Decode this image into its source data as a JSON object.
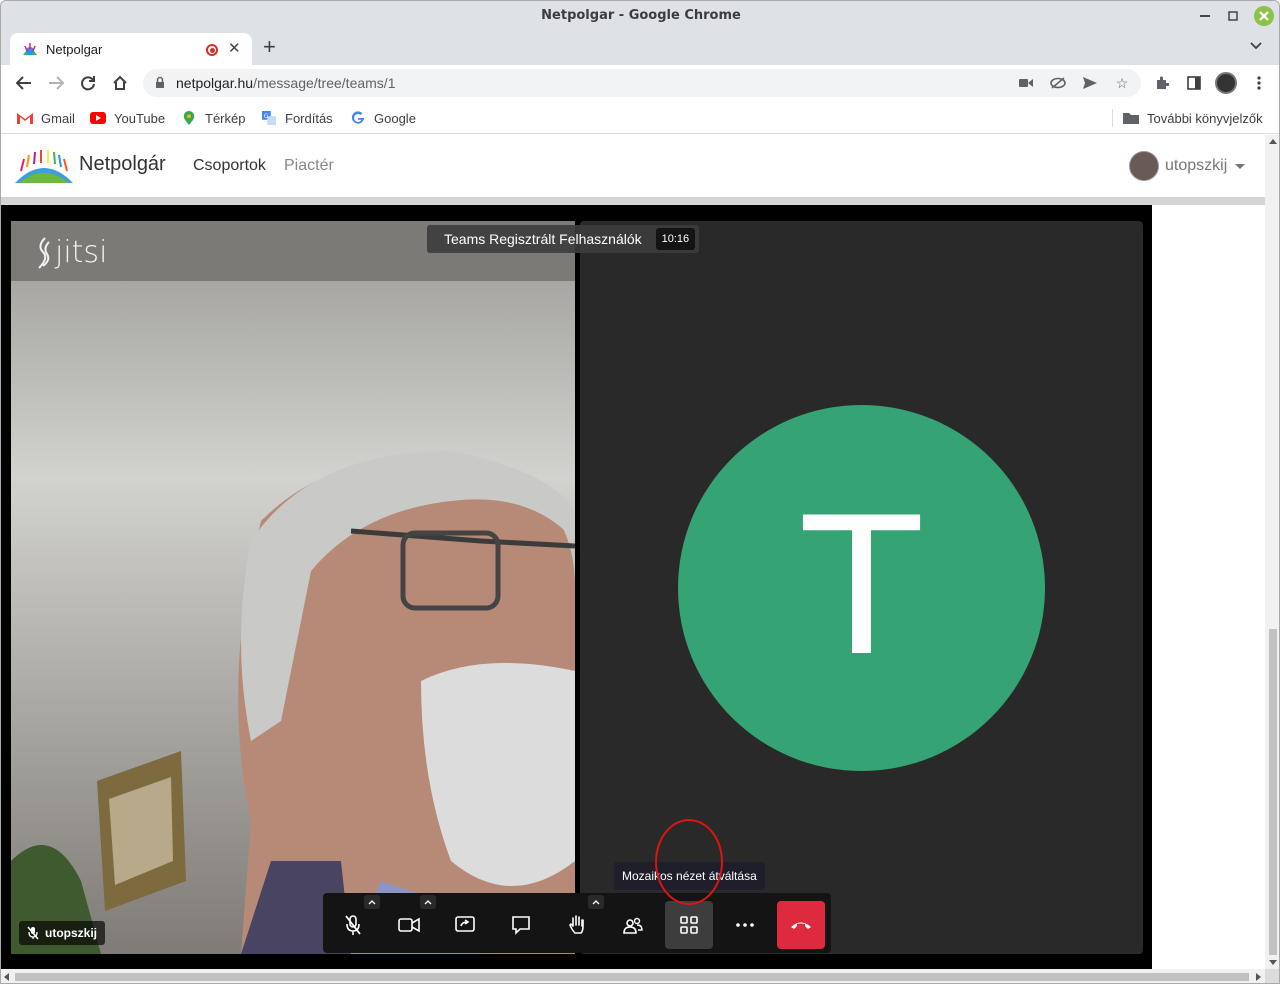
{
  "window": {
    "title": "Netpolgar - Google Chrome"
  },
  "tab": {
    "title": "Netpolgar"
  },
  "address": {
    "host": "netpolgar.hu",
    "path": "/message/tree/teams/1"
  },
  "bookmarks": [
    {
      "label": "Gmail",
      "icon": "gmail-icon"
    },
    {
      "label": "YouTube",
      "icon": "youtube-icon"
    },
    {
      "label": "Térkép",
      "icon": "maps-icon"
    },
    {
      "label": "Fordítás",
      "icon": "translate-icon"
    },
    {
      "label": "Google",
      "icon": "google-icon"
    }
  ],
  "bookmarks_folder": "További könyvjelzők",
  "app": {
    "brand": "Netpolgár",
    "nav": [
      "Csoportok",
      "Piactér"
    ],
    "user": "utopszkij"
  },
  "meeting": {
    "logo": "jitsi",
    "title": "Teams Regisztrált Felhasználók",
    "time": "10:16",
    "local_name": "utopszkij",
    "remote_initial": "T",
    "avatar_color": "#36a374",
    "tooltip": "Mozaikos nézet átváltása",
    "hangup_color": "#dd2a3e"
  }
}
